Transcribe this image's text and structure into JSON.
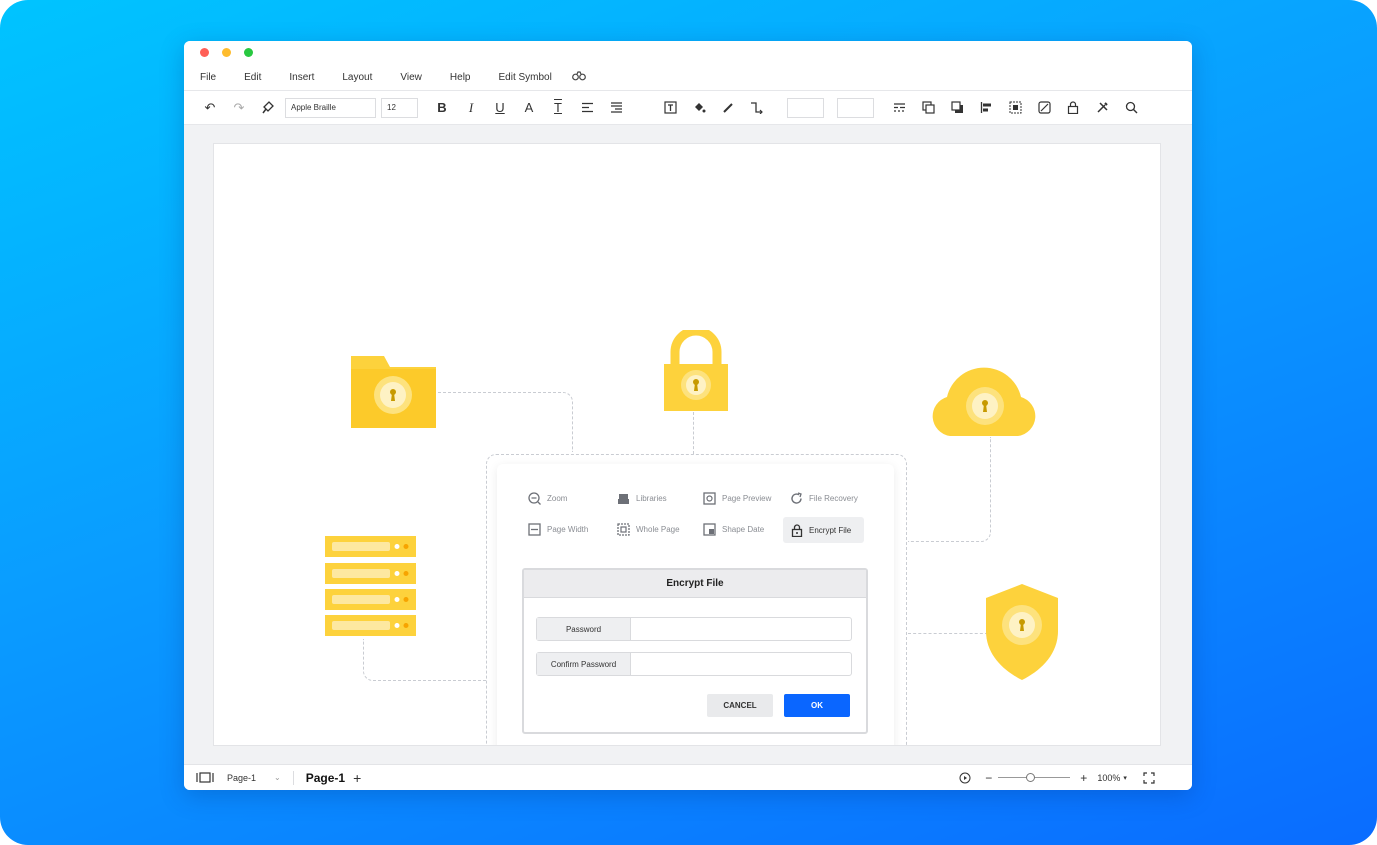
{
  "menu": [
    "File",
    "Edit",
    "Insert",
    "Layout",
    "View",
    "Help",
    "Edit Symbol"
  ],
  "toolbar": {
    "font_name": "Apple Braille",
    "font_size": "12"
  },
  "commands": {
    "zoom": "Zoom",
    "libraries": "Libraries",
    "page_preview": "Page Preview",
    "file_recovery": "File Recovery",
    "page_width": "Page Width",
    "whole_page": "Whole Page",
    "shape_date": "Shape Date",
    "encrypt_file": "Encrypt File"
  },
  "dialog": {
    "title": "Encrypt File",
    "password_label": "Password",
    "password_value": "",
    "confirm_label": "Confirm Password",
    "confirm_value": "",
    "cancel_label": "CANCEL",
    "ok_label": "OK"
  },
  "status": {
    "page_selector": "Page-1",
    "active_tab": "Page-1",
    "add_page": "+",
    "zoom_minus": "−",
    "zoom_plus": "+",
    "zoom_level": "100%",
    "zoom_slider_fraction": 0.45
  },
  "colors": {
    "background": "#0a9cff",
    "accent_yellow": "#fdd23c",
    "ok_button": "#0a66ff",
    "close": "#ff5f57",
    "minimize": "#febc2e",
    "maximize": "#28c840"
  },
  "icons": [
    "undo-icon",
    "redo-icon",
    "format-painter-icon",
    "bold-icon",
    "italic-icon",
    "underline-icon",
    "font-color-icon",
    "text-style-icon",
    "align-icon",
    "line-spacing-icon",
    "textbox-icon",
    "fill-icon",
    "line-color-icon",
    "connector-icon",
    "line-style-icon",
    "bring-front-icon",
    "send-back-icon",
    "align-left-icon",
    "group-icon",
    "no-fill-icon",
    "lock-icon",
    "tools-icon",
    "search-icon",
    "binoculars-icon"
  ]
}
